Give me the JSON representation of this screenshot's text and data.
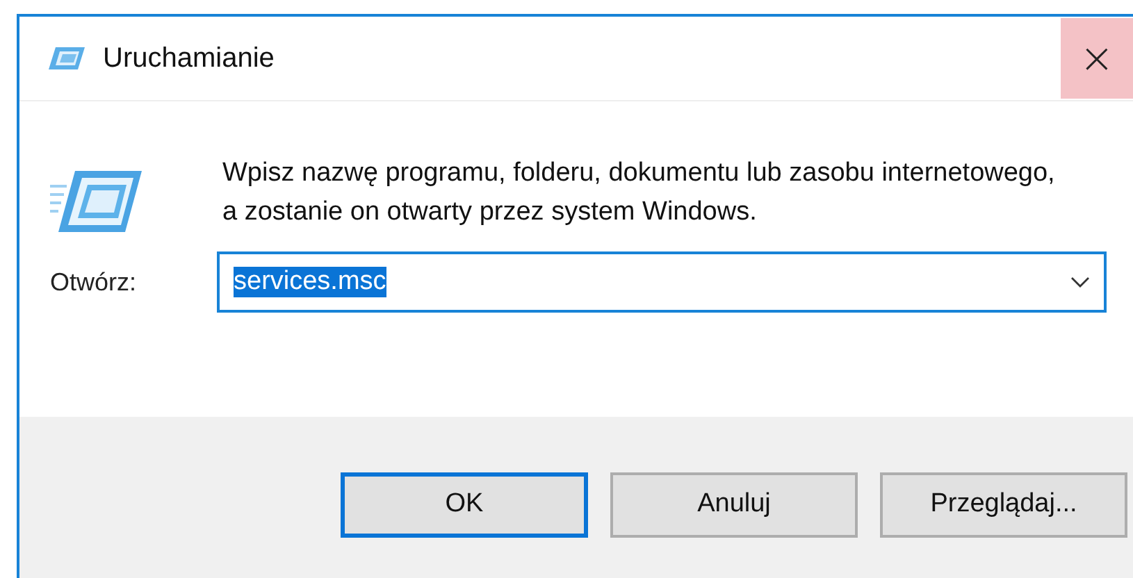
{
  "window": {
    "title": "Uruchamianie",
    "close": "×"
  },
  "description": "Wpisz nazwę programu, folderu, dokumentu lub zasobu internetowego, a zostanie on otwarty przez system Windows.",
  "open_field": {
    "label": "Otwórz:",
    "value": "services.msc",
    "value_selected": true
  },
  "buttons": [
    {
      "label": "OK",
      "default": true
    },
    {
      "label": "Anuluj",
      "default": false
    },
    {
      "label": "Przeglądaj...",
      "default": false
    }
  ]
}
